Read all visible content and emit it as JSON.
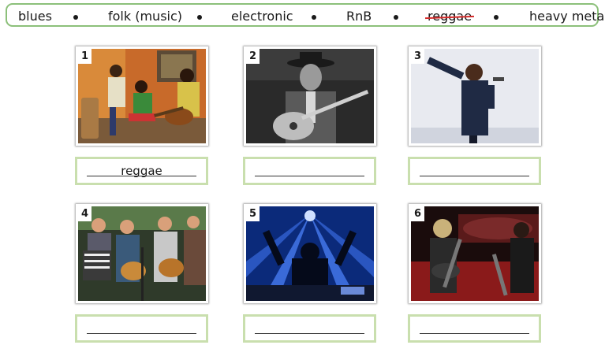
{
  "word_bank": {
    "items": [
      {
        "label": "blues",
        "crossed": false
      },
      {
        "label": "folk (music)",
        "crossed": false
      },
      {
        "label": "electronic",
        "crossed": false
      },
      {
        "label": "RnB",
        "crossed": false
      },
      {
        "label": "reggae",
        "crossed": true
      },
      {
        "label": "heavy metal",
        "crossed": false
      }
    ],
    "strike_color": "#d52b2b",
    "border_color": "#8cc07a"
  },
  "exercise": [
    {
      "number": "1",
      "answer": "reggae",
      "image": "reggae-band-photo"
    },
    {
      "number": "2",
      "answer": "",
      "image": "blues-guitarist-photo"
    },
    {
      "number": "3",
      "answer": "",
      "image": "rnb-singer-photo"
    },
    {
      "number": "4",
      "answer": "",
      "image": "folk-band-photo"
    },
    {
      "number": "5",
      "answer": "",
      "image": "electronic-dj-photo"
    },
    {
      "number": "6",
      "answer": "",
      "image": "heavy-metal-band-photo"
    }
  ],
  "answer_box_color": "#c9dfae"
}
